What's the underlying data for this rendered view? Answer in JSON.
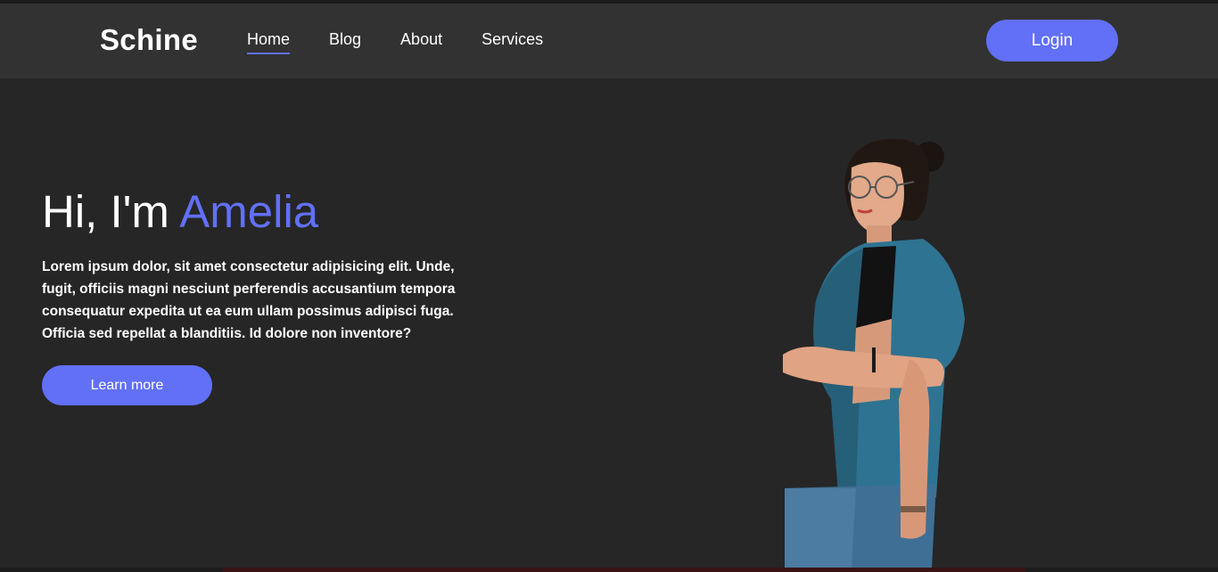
{
  "header": {
    "brand": "Schine",
    "nav": [
      {
        "label": "Home",
        "active": true
      },
      {
        "label": "Blog",
        "active": false
      },
      {
        "label": "About",
        "active": false
      },
      {
        "label": "Services",
        "active": false
      }
    ],
    "login_label": "Login"
  },
  "hero": {
    "greeting": "Hi, I'm",
    "name": "Amelia",
    "paragraph_lines": [
      "Lorem ipsum dolor, sit amet consectetur adipisicing elit. Unde,",
      "fugit, officiis magni nesciunt perferendis accusantium tempora",
      "consequatur expedita ut ea eum ullam possimus adipisci fuga.",
      "Officia sed repellat a blanditiis. Id dolore non inventore?"
    ],
    "cta_label": "Learn more",
    "image": "person-portrait"
  },
  "colors": {
    "accent": "#6170f7",
    "background": "#262626",
    "header_bg": "#323232",
    "text": "#ffffff"
  }
}
